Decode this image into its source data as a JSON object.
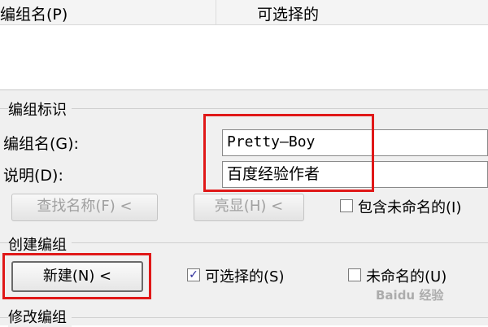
{
  "list": {
    "columns": [
      "编组名(P)",
      "可选择的"
    ]
  },
  "identity_group": {
    "title": "编组标识",
    "name_label": "编组名(G):",
    "name_value": "Pretty—Boy",
    "desc_label": "说明(D):",
    "desc_value": "百度经验作者",
    "find_button": "查找名称(F) <",
    "highlight_button": "亮显(H) <",
    "include_unnamed": {
      "label": "包含未命名的(I)",
      "checked": false
    }
  },
  "create_group": {
    "title": "创建编组",
    "new_button": "新建(N) <",
    "selectable": {
      "label": "可选择的(S)",
      "checked": true
    },
    "unnamed": {
      "label": "未命名的(U)",
      "checked": false
    }
  },
  "modify_group": {
    "title": "修改编组"
  },
  "watermark": {
    "text": "Baidu 经验"
  },
  "colors": {
    "highlight": "#e01818",
    "panel": "#f0f0f0",
    "check": "#2a2a9a"
  }
}
